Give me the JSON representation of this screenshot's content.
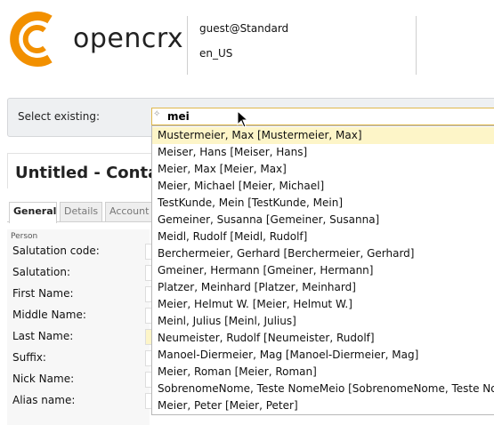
{
  "header": {
    "logo_text": "opencrx",
    "user": "guest@Standard",
    "locale": "en_US"
  },
  "select_existing": {
    "label": "Select existing:",
    "value": "mei"
  },
  "page": {
    "title": "Untitled - Conta"
  },
  "tabs": [
    "General",
    "Details",
    "Account"
  ],
  "form": {
    "section": "Person",
    "fields": [
      "Salutation code:",
      "Salutation:",
      "First Name:",
      "Middle Name:",
      "Last Name:",
      "Suffix:",
      "Nick Name:",
      "Alias name:"
    ]
  },
  "dropdown": {
    "items": [
      "Mustermeier, Max [Mustermeier, Max]",
      "Meiser, Hans [Meiser, Hans]",
      "Meier, Max [Meier, Max]",
      "Meier, Michael [Meier, Michael]",
      "TestKunde, Mein [TestKunde, Mein]",
      "Gemeiner, Susanna [Gemeiner, Susanna]",
      "Meidl, Rudolf [Meidl, Rudolf]",
      "Berchermeier, Gerhard [Berchermeier, Gerhard]",
      "Gmeiner, Hermann [Gmeiner, Hermann]",
      "Platzer, Meinhard [Platzer, Meinhard]",
      "Meier, Helmut W. [Meier, Helmut W.]",
      "Meinl, Julius [Meinl, Julius]",
      "Neumeister, Rudolf [Neumeister, Rudolf]",
      "Manoel-Diermeier, Mag [Manoel-Diermeier, Mag]",
      "Meier, Roman [Meier, Roman]",
      "SobrenomeNome, Teste NomeMeio [SobrenomeNome, Teste No",
      "Meier, Peter [Meier, Peter]"
    ],
    "active_index": 0
  },
  "colors": {
    "brand_orange": "#f29000",
    "highlight": "#fdf5c8",
    "input_border": "#e0b84c"
  }
}
